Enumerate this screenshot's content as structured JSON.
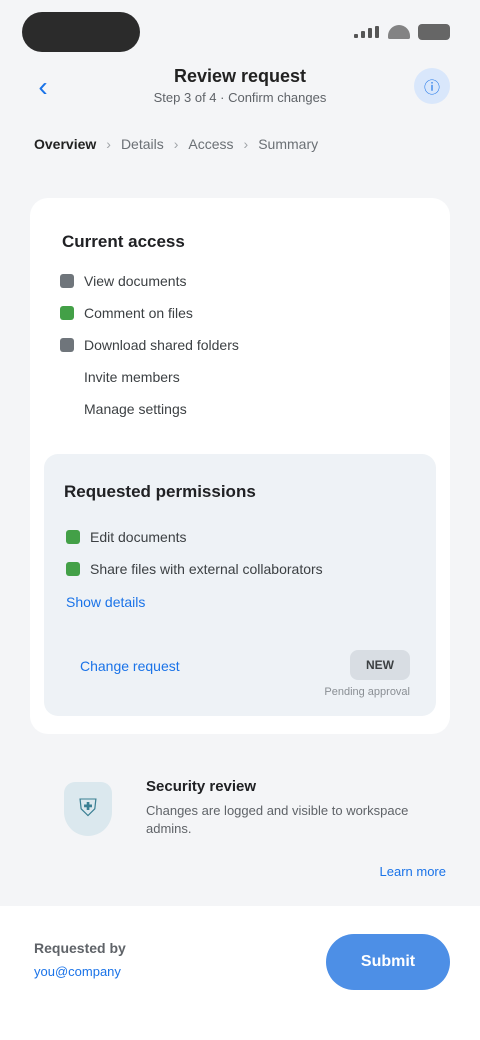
{
  "status_bar": {
    "icons": [
      "signal-icon",
      "wifi-icon",
      "battery-icon"
    ]
  },
  "header": {
    "back_icon": "chevron-left-icon",
    "title": "Review request",
    "subtitle": "Step 3 of 4 · Confirm changes",
    "action_icon": "info-icon"
  },
  "breadcrumb": {
    "items": [
      "Overview",
      "Details",
      "Access",
      "Summary"
    ],
    "active_index": 0
  },
  "card": {
    "section_title": "Current access",
    "items": [
      {
        "label": "View documents",
        "check": "gray"
      },
      {
        "label": "Comment on files",
        "check": "green"
      },
      {
        "label": "Download shared folders",
        "check": "gray"
      },
      {
        "label": "Invite members",
        "check": "none"
      },
      {
        "label": "Manage settings",
        "check": "none"
      }
    ],
    "requested": {
      "title": "Requested permissions",
      "items": [
        {
          "label": "Edit documents",
          "check": "green"
        },
        {
          "label": "Share files with external collaborators",
          "check": "green"
        }
      ],
      "link": "Show details",
      "bottom_link": "Change request",
      "badge": "NEW",
      "caption": "Pending approval"
    }
  },
  "info": {
    "icon": "shield-icon",
    "title": "Security review",
    "text": "Changes are logged and visible to workspace admins."
  },
  "more_link": "Learn more",
  "footer": {
    "label": "Requested by",
    "value": "you@company",
    "primary_button": "Submit"
  },
  "colors": {
    "accent": "#1a73e8",
    "button": "#4d8fe6",
    "success": "#43a047",
    "panel": "#eef2f6",
    "background": "#f4f5f7"
  }
}
